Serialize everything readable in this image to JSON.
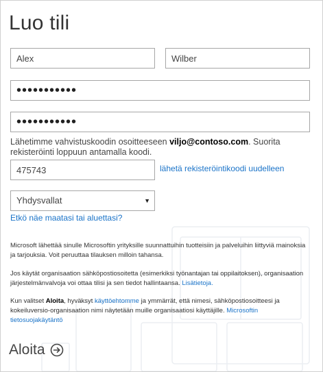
{
  "page": {
    "title": "Luo tili"
  },
  "form": {
    "first_name": "Alex",
    "last_name": "Wilber",
    "password_mask": "•••••••••••",
    "confirm_password_mask": "•••••••••••",
    "verification": {
      "text_before": "Lähetimme vahvistuskoodin osoitteeseen ",
      "email": "viljo@contoso.com",
      "text_after": ". Suorita rekisteröinti loppuun antamalla koodi.",
      "code": "475743",
      "resend_link": "lähetä rekisteröintikoodi uudelleen"
    },
    "country": {
      "selected": "Yhdysvallat",
      "help_link": "Etkö näe maatasi tai aluettasi?"
    }
  },
  "legal": {
    "p1": "Microsoft lähettää sinulle Microsoftin yrityksille suunnattuihin tuotteisiin ja palveluihin liittyviä mainoksia ja tarjouksia. Voit peruuttaa tilauksen milloin tahansa.",
    "p2_text": "Jos käytät organisaation sähköpostiosoitetta (esimerkiksi työnantajan tai oppilaitoksen), organisaation järjestelmänvalvoja voi ottaa tilisi ja sen tiedot hallintaansa. ",
    "p2_link": "Lisätietoja.",
    "p3_a": "Kun valitset ",
    "p3_bold": "Aloita",
    "p3_b": ", hyväksyt ",
    "p3_link1": "käyttöehtomme",
    "p3_c": " ja ymmärrät, että nimesi, sähköpostiosoitteesi ja kokeiluversio-organisaation nimi näytetään muille organisaatiosi käyttäjille. ",
    "p3_link2": "Microsoftin tietosuojakäytäntö"
  },
  "actions": {
    "start_label": "Aloita",
    "start_icon": "arrow-right-circle-icon"
  },
  "colors": {
    "link": "#1a73c8",
    "border": "#a6a6a6",
    "text": "#333333"
  }
}
